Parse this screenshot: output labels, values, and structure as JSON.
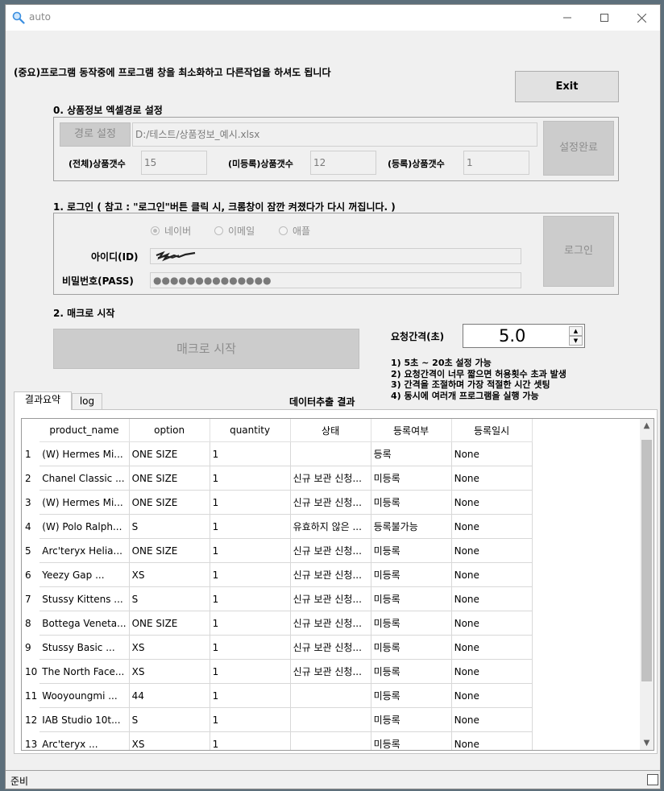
{
  "window": {
    "title": "auto"
  },
  "notice": "(중요)프로그램 동작중에 프로그램 창을 최소화하고 다른작업을 하셔도 됩니다",
  "exit_label": "Exit",
  "section0": {
    "title": "0. 상품정보 엑셀경로 설정",
    "path_button": "경로 설정",
    "path_value": "D:/테스트/상품정보_예시.xlsx",
    "complete_button": "설정완료",
    "total_label": "(전체)상품갯수",
    "total_value": "15",
    "unreg_label": "(미등록)상품갯수",
    "unreg_value": "12",
    "reg_label": "(등록)상품갯수",
    "reg_value": "1"
  },
  "section1": {
    "title": "1. 로그인 ( 참고 : \"로그인\"버튼 클릭 시, 크롬창이 잠깐 켜졌다가 다시 꺼집니다. )",
    "radio_naver": "네이버",
    "radio_email": "이메일",
    "radio_apple": "애플",
    "id_label": "아이디(ID)",
    "pw_label": "비밀번호(PASS)",
    "pw_value": "●●●●●●●●●●●●●●",
    "login_button": "로그인"
  },
  "section2": {
    "title": "2. 매크로 시작",
    "start_button": "매크로 시작",
    "interval_label": "요청간격(초)",
    "interval_value": "5.0",
    "notes": [
      "1) 5초 ~ 20초 설정 가능",
      "2) 요청간격이 너무 짧으면 허용횟수 초과 발생",
      "3) 간격을 조절하며 가장 적절한 시간 셋팅",
      "4) 동시에 여러개 프로그램을 실행 가능"
    ]
  },
  "tabs": [
    "결과요약",
    "log"
  ],
  "result_title": "데이터추출 결과",
  "table": {
    "columns": [
      "product_name",
      "option",
      "quantity",
      "상태",
      "등록여부",
      "등록일시"
    ],
    "rows": [
      [
        "1",
        "(W) Hermes Mi...",
        "ONE SIZE",
        "1",
        "",
        "등록",
        "None"
      ],
      [
        "2",
        "Chanel Classic ...",
        "ONE SIZE",
        "1",
        "신규 보관 신청...",
        "미등록",
        "None"
      ],
      [
        "3",
        "(W) Hermes Mi...",
        "ONE SIZE",
        "1",
        "신규 보관 신청...",
        "미등록",
        "None"
      ],
      [
        "4",
        "(W) Polo Ralph...",
        "S",
        "1",
        "유효하지 않은 ...",
        "등록불가능",
        "None"
      ],
      [
        "5",
        "Arc'teryx Helia...",
        "ONE SIZE",
        "1",
        "신규 보관 신청...",
        "미등록",
        "None"
      ],
      [
        "6",
        "Yeezy Gap ...",
        "XS",
        "1",
        "신규 보관 신청...",
        "미등록",
        "None"
      ],
      [
        "7",
        "Stussy Kittens ...",
        "S",
        "1",
        "신규 보관 신청...",
        "미등록",
        "None"
      ],
      [
        "8",
        "Bottega Veneta...",
        "ONE SIZE",
        "1",
        "신규 보관 신청...",
        "미등록",
        "None"
      ],
      [
        "9",
        "Stussy Basic ...",
        "XS",
        "1",
        "신규 보관 신청...",
        "미등록",
        "None"
      ],
      [
        "10",
        "The North Face...",
        "XS",
        "1",
        "신규 보관 신청...",
        "미등록",
        "None"
      ],
      [
        "11",
        "Wooyoungmi ...",
        "44",
        "1",
        "",
        "미등록",
        "None"
      ],
      [
        "12",
        "IAB Studio 10t...",
        "S",
        "1",
        "",
        "미등록",
        "None"
      ],
      [
        "13",
        "Arc'teryx ...",
        "XS",
        "1",
        "",
        "미등록",
        "None"
      ]
    ]
  },
  "status": "준비",
  "icons": {
    "app": "magnifier-icon",
    "minimize": "minimize-icon",
    "maximize": "maximize-icon",
    "close": "close-icon"
  }
}
